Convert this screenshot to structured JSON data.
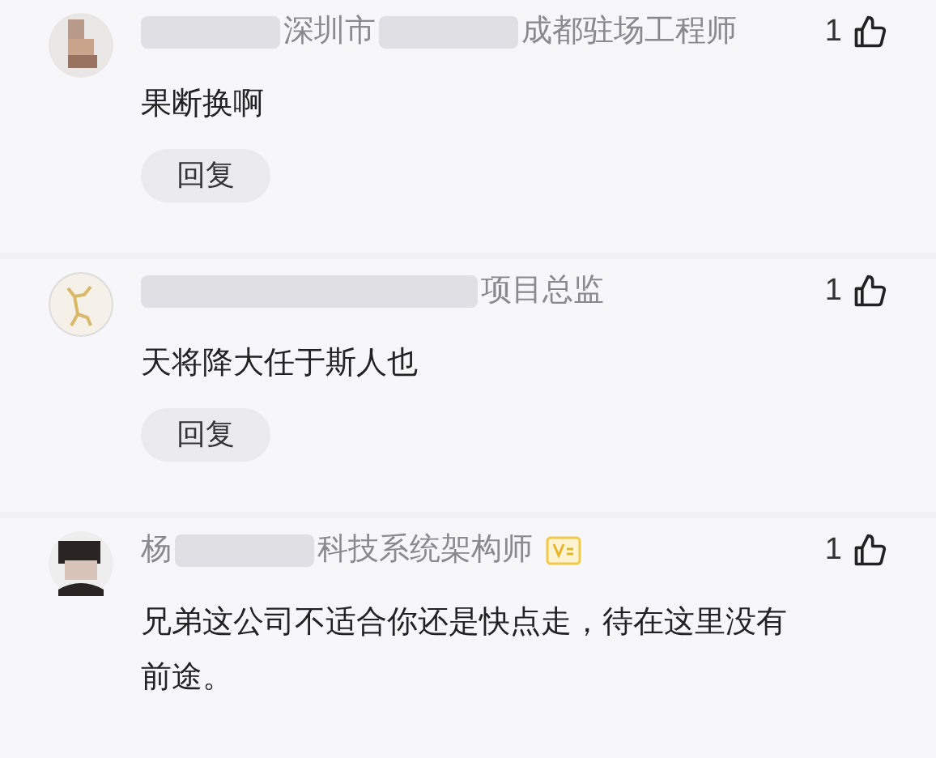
{
  "comments": [
    {
      "avatar": {
        "kind": "mosaic"
      },
      "author": [
        {
          "kind": "blur"
        },
        {
          "kind": "text",
          "text": "深圳市"
        },
        {
          "kind": "blur"
        },
        {
          "kind": "text",
          "text": "成都驻场工程师"
        }
      ],
      "verified": false,
      "likes": "1",
      "body": "果断换啊",
      "reply": "回复"
    },
    {
      "avatar": {
        "kind": "deer"
      },
      "author": [
        {
          "kind": "blurlong"
        },
        {
          "kind": "text",
          "text": "项目总监"
        }
      ],
      "verified": false,
      "likes": "1",
      "body": "天将降大任于斯人也",
      "reply": "回复"
    },
    {
      "avatar": {
        "kind": "figure"
      },
      "author": [
        {
          "kind": "text",
          "text": "杨"
        },
        {
          "kind": "blur"
        },
        {
          "kind": "text",
          "text": "科技系统架构师"
        }
      ],
      "verified": true,
      "likes": "1",
      "body": "兄弟这公司不适合你还是快点走，待在这里没有前途。"
    }
  ]
}
